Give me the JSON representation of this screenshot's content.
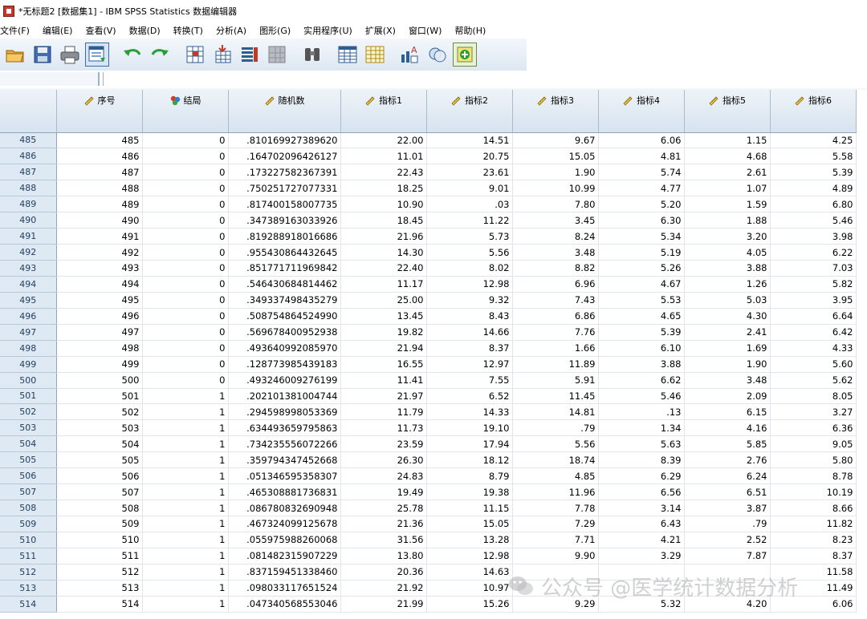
{
  "window": {
    "title": "*无标题2 [数据集1] - IBM SPSS Statistics 数据编辑器",
    "icon": "spss-app-icon"
  },
  "menu": [
    "文件(F)",
    "编辑(E)",
    "查看(V)",
    "数据(D)",
    "转换(T)",
    "分析(A)",
    "图形(G)",
    "实用程序(U)",
    "扩展(X)",
    "窗口(W)",
    "帮助(H)"
  ],
  "toolbar": {
    "buttons": [
      {
        "icon": "open-folder-icon"
      },
      {
        "icon": "save-icon"
      },
      {
        "icon": "print-icon"
      },
      {
        "icon": "dialog-recall-icon",
        "selected": true
      },
      {
        "icon": "undo-icon"
      },
      {
        "icon": "redo-icon"
      },
      {
        "icon": "goto-case-icon"
      },
      {
        "icon": "goto-variable-icon"
      },
      {
        "icon": "variables-icon"
      },
      {
        "icon": "run-descriptives-icon"
      },
      {
        "icon": "find-icon"
      },
      {
        "icon": "insert-cases-icon"
      },
      {
        "icon": "insert-variable-icon"
      },
      {
        "icon": "split-file-icon"
      },
      {
        "icon": "weight-cases-icon"
      },
      {
        "icon": "value-labels-icon"
      }
    ]
  },
  "grid": {
    "columns": [
      {
        "name": "序号",
        "icon": "scale-ruler-icon"
      },
      {
        "name": "结局",
        "icon": "nominal-balls-icon"
      },
      {
        "name": "随机数",
        "icon": "scale-ruler-icon"
      },
      {
        "name": "指标1",
        "icon": "scale-ruler-icon"
      },
      {
        "name": "指标2",
        "icon": "scale-ruler-icon"
      },
      {
        "name": "指标3",
        "icon": "scale-ruler-icon"
      },
      {
        "name": "指标4",
        "icon": "scale-ruler-icon"
      },
      {
        "name": "指标5",
        "icon": "scale-ruler-icon"
      },
      {
        "name": "指标6",
        "icon": "scale-ruler-icon"
      }
    ],
    "rows": [
      {
        "n": "485",
        "cells": [
          "485",
          "0",
          ".810169927389620",
          "22.00",
          "14.51",
          "9.67",
          "6.06",
          "1.15",
          "4.25"
        ]
      },
      {
        "n": "486",
        "cells": [
          "486",
          "0",
          ".164702096426127",
          "11.01",
          "20.75",
          "15.05",
          "4.81",
          "4.68",
          "5.58"
        ]
      },
      {
        "n": "487",
        "cells": [
          "487",
          "0",
          ".173227582367391",
          "22.43",
          "23.61",
          "1.90",
          "5.74",
          "2.61",
          "5.39"
        ]
      },
      {
        "n": "488",
        "cells": [
          "488",
          "0",
          ".750251727077331",
          "18.25",
          "9.01",
          "10.99",
          "4.77",
          "1.07",
          "4.89"
        ]
      },
      {
        "n": "489",
        "cells": [
          "489",
          "0",
          ".817400158007735",
          "10.90",
          ".03",
          "7.80",
          "5.20",
          "1.59",
          "6.80"
        ]
      },
      {
        "n": "490",
        "cells": [
          "490",
          "0",
          ".347389163033926",
          "18.45",
          "11.22",
          "3.45",
          "6.30",
          "1.88",
          "5.46"
        ]
      },
      {
        "n": "491",
        "cells": [
          "491",
          "0",
          ".819288918016686",
          "21.96",
          "5.73",
          "8.24",
          "5.34",
          "3.20",
          "3.98"
        ]
      },
      {
        "n": "492",
        "cells": [
          "492",
          "0",
          ".955430864432645",
          "14.30",
          "5.56",
          "3.48",
          "5.19",
          "4.05",
          "6.22"
        ]
      },
      {
        "n": "493",
        "cells": [
          "493",
          "0",
          ".851771711969842",
          "22.40",
          "8.02",
          "8.82",
          "5.26",
          "3.88",
          "7.03"
        ]
      },
      {
        "n": "494",
        "cells": [
          "494",
          "0",
          ".546430684814462",
          "11.17",
          "12.98",
          "6.96",
          "4.67",
          "1.26",
          "5.82"
        ]
      },
      {
        "n": "495",
        "cells": [
          "495",
          "0",
          ".349337498435279",
          "25.00",
          "9.32",
          "7.43",
          "5.53",
          "5.03",
          "3.95"
        ]
      },
      {
        "n": "496",
        "cells": [
          "496",
          "0",
          ".508754864524990",
          "13.45",
          "8.43",
          "6.86",
          "4.65",
          "4.30",
          "6.64"
        ]
      },
      {
        "n": "497",
        "cells": [
          "497",
          "0",
          ".569678400952938",
          "19.82",
          "14.66",
          "7.76",
          "5.39",
          "2.41",
          "6.42"
        ]
      },
      {
        "n": "498",
        "cells": [
          "498",
          "0",
          ".493640992085970",
          "21.94",
          "8.37",
          "1.66",
          "6.10",
          "1.69",
          "4.33"
        ]
      },
      {
        "n": "499",
        "cells": [
          "499",
          "0",
          ".128773985439183",
          "16.55",
          "12.97",
          "11.89",
          "3.88",
          "1.90",
          "5.60"
        ]
      },
      {
        "n": "500",
        "cells": [
          "500",
          "0",
          ".493246009276199",
          "11.41",
          "7.55",
          "5.91",
          "6.62",
          "3.48",
          "5.62"
        ]
      },
      {
        "n": "501",
        "cells": [
          "501",
          "1",
          ".202101381004744",
          "21.97",
          "6.52",
          "11.45",
          "5.46",
          "2.09",
          "8.05"
        ]
      },
      {
        "n": "502",
        "cells": [
          "502",
          "1",
          ".294598998053369",
          "11.79",
          "14.33",
          "14.81",
          ".13",
          "6.15",
          "3.27"
        ]
      },
      {
        "n": "503",
        "cells": [
          "503",
          "1",
          ".634493659795863",
          "11.73",
          "19.10",
          ".79",
          "1.34",
          "4.16",
          "6.36"
        ]
      },
      {
        "n": "504",
        "cells": [
          "504",
          "1",
          ".734235556072266",
          "23.59",
          "17.94",
          "5.56",
          "5.63",
          "5.85",
          "9.05"
        ]
      },
      {
        "n": "505",
        "cells": [
          "505",
          "1",
          ".359794347452668",
          "26.30",
          "18.12",
          "18.74",
          "8.39",
          "2.76",
          "5.80"
        ]
      },
      {
        "n": "506",
        "cells": [
          "506",
          "1",
          ".051346595358307",
          "24.83",
          "8.79",
          "4.85",
          "6.29",
          "6.24",
          "8.78"
        ]
      },
      {
        "n": "507",
        "cells": [
          "507",
          "1",
          ".465308881736831",
          "19.49",
          "19.38",
          "11.96",
          "6.56",
          "6.51",
          "10.19"
        ]
      },
      {
        "n": "508",
        "cells": [
          "508",
          "1",
          ".086780832690948",
          "25.78",
          "11.15",
          "7.78",
          "3.14",
          "3.87",
          "8.66"
        ]
      },
      {
        "n": "509",
        "cells": [
          "509",
          "1",
          ".467324099125678",
          "21.36",
          "15.05",
          "7.29",
          "6.43",
          ".79",
          "11.82"
        ]
      },
      {
        "n": "510",
        "cells": [
          "510",
          "1",
          ".055975988260068",
          "31.56",
          "13.28",
          "7.71",
          "4.21",
          "2.52",
          "8.23"
        ]
      },
      {
        "n": "511",
        "cells": [
          "511",
          "1",
          ".081482315907229",
          "13.80",
          "12.98",
          "9.90",
          "3.29",
          "7.87",
          "8.37"
        ]
      },
      {
        "n": "512",
        "cells": [
          "512",
          "1",
          ".837159451338460",
          "20.36",
          "14.63",
          "",
          "",
          "",
          "11.58"
        ]
      },
      {
        "n": "513",
        "cells": [
          "513",
          "1",
          ".098033117651524",
          "21.92",
          "10.97",
          "",
          "",
          "",
          "11.49"
        ]
      },
      {
        "n": "514",
        "cells": [
          "514",
          "1",
          ".047340568553046",
          "21.99",
          "15.26",
          "9.29",
          "5.32",
          "4.20",
          "6.06"
        ]
      }
    ]
  },
  "watermark": {
    "text": "公众号 @医学统计数据分析",
    "icon": "wechat-icon"
  }
}
